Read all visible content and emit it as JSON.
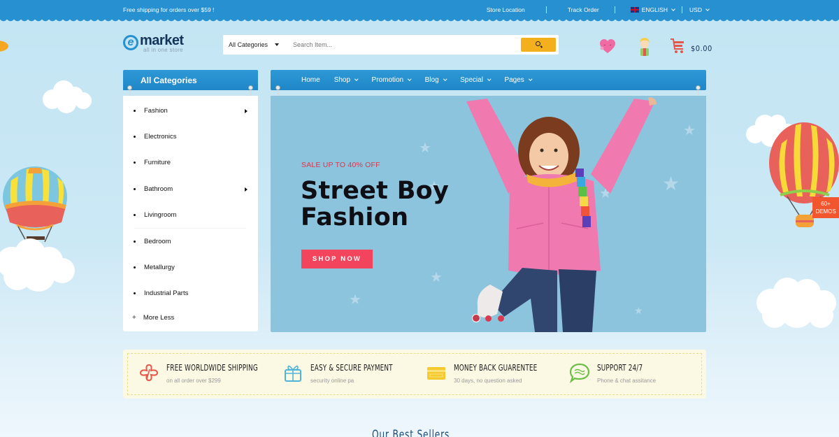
{
  "topbar": {
    "shipping_notice": "Free shipping for orders over $59 !",
    "store_location": "Store Location",
    "track_order": "Track Order",
    "language": "ENGLISH",
    "currency": "USD"
  },
  "header": {
    "logo_word": "market",
    "logo_letter": "e",
    "logo_tagline": "all in one store",
    "search": {
      "category": "All Categories",
      "placeholder": "Search Item..."
    },
    "icons": [
      "wishlist-heart-icon",
      "account-user-icon",
      "cart-icon"
    ],
    "cart_total": "$0.00"
  },
  "categories": {
    "title": "All Categories",
    "items": [
      {
        "label": "Fashion",
        "has_submenu": true
      },
      {
        "label": "Electronics",
        "has_submenu": false
      },
      {
        "label": "Furniture",
        "has_submenu": false
      },
      {
        "label": "Bathroom",
        "has_submenu": true
      },
      {
        "label": "Livingroom",
        "has_submenu": false
      },
      {
        "label": "Bedroom",
        "has_submenu": false
      },
      {
        "label": "Metallurgy",
        "has_submenu": false
      },
      {
        "label": "Industrial Parts",
        "has_submenu": false
      }
    ],
    "more_less": "More Less"
  },
  "nav": {
    "items": [
      {
        "label": "Home",
        "dropdown": false
      },
      {
        "label": "Shop",
        "dropdown": true
      },
      {
        "label": "Promotion",
        "dropdown": true
      },
      {
        "label": "Blog",
        "dropdown": true
      },
      {
        "label": "Special",
        "dropdown": true
      },
      {
        "label": "Pages",
        "dropdown": true
      }
    ]
  },
  "hero": {
    "sale_text": "SALE UP TO 40% OFF",
    "title_line1": "Street Boy",
    "title_line2": "Fashion",
    "cta": "SHOP NOW",
    "slides_total": 3,
    "active_slide": 1
  },
  "features": [
    {
      "title": "FREE WORLDWIDE SHIPPING",
      "subtitle": "on all order over $299",
      "icon": "shipping-plane-icon"
    },
    {
      "title": "EASY & SECURE PAYMENT",
      "subtitle": "security online pa",
      "icon": "gift-box-icon"
    },
    {
      "title": "MONEY BACK GUARENTEE",
      "subtitle": "30 days, no question asked",
      "icon": "credit-card-icon"
    },
    {
      "title": "SUPPORT 24/7",
      "subtitle": "Phone & chat assitance",
      "icon": "chat-bubble-icon"
    }
  ],
  "section_heading": "Our Best Sellers",
  "demos_badge": {
    "line1": "60+",
    "line2": "DEMOS"
  },
  "colors": {
    "primary_blue": "#2690d0",
    "search_button": "#f3b01c",
    "cta_red": "#f2455d",
    "hero_bg": "#8cc4de",
    "navy_text": "#14345a",
    "feature_bg": "#fbf8e4",
    "demos_orange": "#f2562e"
  }
}
